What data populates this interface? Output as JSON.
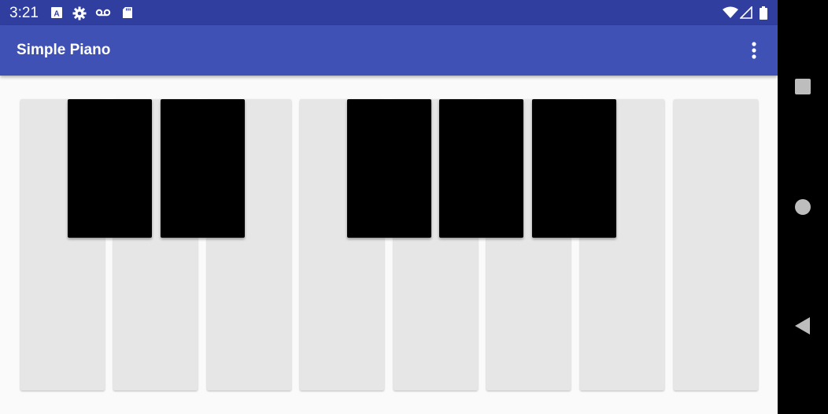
{
  "status_bar": {
    "time": "3:21",
    "left_icons": [
      "font-a-icon",
      "gear-icon",
      "voicemail-icon",
      "sd-card-icon"
    ],
    "right_icons": [
      "wifi-icon",
      "signal-icon",
      "battery-icon"
    ]
  },
  "app_bar": {
    "title": "Simple Piano",
    "overflow_icon": "more-vert-icon"
  },
  "keyboard": {
    "white_key_count": 8,
    "black_key_count": 5
  },
  "nav_bar": {
    "buttons": [
      "recents-icon",
      "home-icon",
      "back-icon"
    ]
  },
  "colors": {
    "status_bar": "#303f9f",
    "app_bar": "#3f51b5",
    "background": "#fafafa",
    "white_key": "#e6e6e6",
    "black_key": "#000000"
  }
}
